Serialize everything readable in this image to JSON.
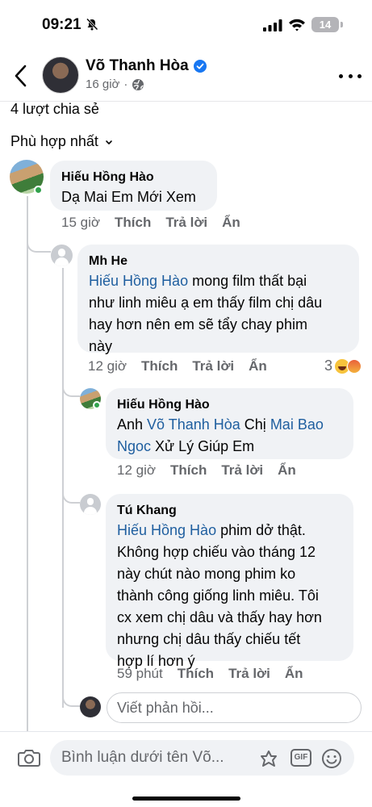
{
  "status_bar": {
    "time": "09:21",
    "battery": "14"
  },
  "header": {
    "name": "Võ Thanh Hòa",
    "time": "16 giờ",
    "back_icon": "chevron-left-icon",
    "more_icon": "more-horizontal-icon"
  },
  "post": {
    "shares": "4 lượt chia sẻ",
    "sort_label": "Phù hợp nhất"
  },
  "comments": [
    {
      "author": "Hiếu Hồng Hào",
      "text": "Dạ Mai Em Mới Xem",
      "time": "15 giờ",
      "like": "Thích",
      "reply": "Trả lời",
      "hide": "Ẩn"
    },
    {
      "author": "Mh He",
      "mention": "Hiếu Hồng Hào",
      "text_1": " mong film thất bại",
      "text_2": "như linh miêu ạ em thấy film chị dâu",
      "text_3": "hay hơn nên em sẽ tẩy chay phim",
      "text_4": "này",
      "time": "12 giờ",
      "like": "Thích",
      "reply": "Trả lời",
      "hide": "Ẩn",
      "reaction_count": "3"
    },
    {
      "author": "Hiếu Hồng Hào",
      "prefix": "Anh ",
      "mention_1": "Võ Thanh Hòa",
      "middle": " Chị ",
      "mention_2a": "Mai Bao",
      "mention_2b": "Ngoc",
      "suffix": " Xử Lý Giúp Em",
      "time": "12 giờ",
      "like": "Thích",
      "reply": "Trả lời",
      "hide": "Ẩn"
    },
    {
      "author": "Tú Khang",
      "mention": "Hiếu Hồng Hào",
      "text_1": " phim dở thật.",
      "text_2": "Không hợp chiếu vào tháng 12",
      "text_3": "này chút nào mong phim ko",
      "text_4": "thành công giống linh miêu. Tôi",
      "text_5": "cx xem chị dâu và thấy hay hơn",
      "text_6": "nhưng chị dâu thấy chiếu tết",
      "text_7": "hợp lí hơn ý",
      "time": "59 phút",
      "like": "Thích",
      "reply": "Trả lời",
      "hide": "Ẩn"
    }
  ],
  "reply_input": {
    "placeholder": "Viết phản hồi..."
  },
  "bottom_bar": {
    "placeholder": "Bình luận dưới tên Võ...",
    "gif_label": "GIF"
  },
  "colors": {
    "mention": "#1e5e9f",
    "bubble": "#f0f2f5",
    "verified": "#1877f2",
    "online": "#31a24c"
  }
}
